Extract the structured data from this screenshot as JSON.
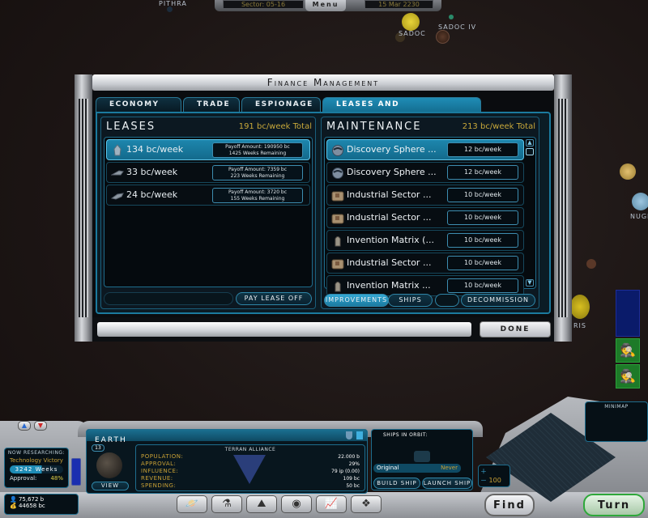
{
  "map": {
    "labels": [
      {
        "name": "Pithra"
      },
      {
        "name": "Sadoc"
      },
      {
        "name": "Sadoc IV"
      },
      {
        "name": "Nuge"
      },
      {
        "name": "Ris"
      }
    ]
  },
  "topbar": {
    "sector": "Sector: 05-16",
    "menu": "Menu",
    "date": "15 Mar 2230"
  },
  "dialog": {
    "title": "Finance Management",
    "tabs": [
      {
        "label": "Economy",
        "active": false
      },
      {
        "label": "Trade",
        "active": false
      },
      {
        "label": "Espionage",
        "active": false
      },
      {
        "label": "Leases and Maintenance",
        "active": true
      }
    ],
    "leases": {
      "title": "Leases",
      "total": "191 bc/week Total",
      "items": [
        {
          "icon": "ship-icon",
          "amount": "134 bc/week",
          "payoff": "Payoff Amount: 190950 bc",
          "remaining": "1425 Weeks Remaining",
          "selected": true
        },
        {
          "icon": "ship-icon",
          "amount": "33 bc/week",
          "payoff": "Payoff Amount: 7359 bc",
          "remaining": "223 Weeks Remaining",
          "selected": false
        },
        {
          "icon": "ship-icon",
          "amount": "24 bc/week",
          "payoff": "Payoff Amount: 3720 bc",
          "remaining": "155 Weeks Remaining",
          "selected": false
        }
      ],
      "pay_button": "Pay Lease Off"
    },
    "maintenance": {
      "title": "Maintenance",
      "total": "213 bc/week Total",
      "items": [
        {
          "icon": "discovery-sphere-icon",
          "name": "Discovery Sphere ...",
          "cost": "12 bc/week",
          "selected": true
        },
        {
          "icon": "discovery-sphere-icon",
          "name": "Discovery Sphere ...",
          "cost": "12 bc/week",
          "selected": false
        },
        {
          "icon": "industrial-sector-icon",
          "name": "Industrial Sector ...",
          "cost": "10 bc/week",
          "selected": false
        },
        {
          "icon": "industrial-sector-icon",
          "name": "Industrial Sector ...",
          "cost": "10 bc/week",
          "selected": false
        },
        {
          "icon": "invention-matrix-icon",
          "name": "Invention Matrix (...",
          "cost": "10 bc/week",
          "selected": false
        },
        {
          "icon": "industrial-sector-icon",
          "name": "Industrial Sector ...",
          "cost": "10 bc/week",
          "selected": false
        },
        {
          "icon": "invention-matrix-icon",
          "name": "Invention Matrix ...",
          "cost": "10 bc/week",
          "selected": false
        }
      ],
      "scroll_up": "▲",
      "scroll_down": "▼",
      "filter_improvements": "Improvements",
      "filter_ships": "Ships",
      "decommission": "Decommission"
    },
    "done": "Done"
  },
  "hud": {
    "research": {
      "header": "Now Researching:",
      "tech": "Technology Victory",
      "weeks": "3242 Weeks",
      "approval_label": "Approval:",
      "approval_value": "48%"
    },
    "totals": {
      "population": "75,672 b",
      "credits": "44658 bc"
    },
    "planet": {
      "name": "Earth",
      "level": "13",
      "view": "View",
      "owner": "Terran Alliance",
      "stats": [
        {
          "label": "Population:",
          "value": "22.000 b"
        },
        {
          "label": "Approval:",
          "value": "29%"
        },
        {
          "label": "Influence:",
          "value": "79 ip (0.00)"
        },
        {
          "label": "Revenue:",
          "value": "109 bc"
        },
        {
          "label": "Spending:",
          "value": "50 bc"
        }
      ]
    },
    "orbit": {
      "title": "Ships in Orbit:",
      "queue_name": "Original",
      "queue_status": "Never",
      "build": "Build Ship",
      "launch": "Launch Ship"
    },
    "minimap": {
      "title": "Minimap",
      "zoom": "100"
    },
    "find": "Find",
    "turn": "Turn",
    "nav": [
      {
        "icon": "planets-icon"
      },
      {
        "icon": "research-icon"
      },
      {
        "icon": "government-icon"
      },
      {
        "icon": "civilization-icon"
      },
      {
        "icon": "graphs-icon"
      },
      {
        "icon": "races-icon"
      }
    ]
  }
}
